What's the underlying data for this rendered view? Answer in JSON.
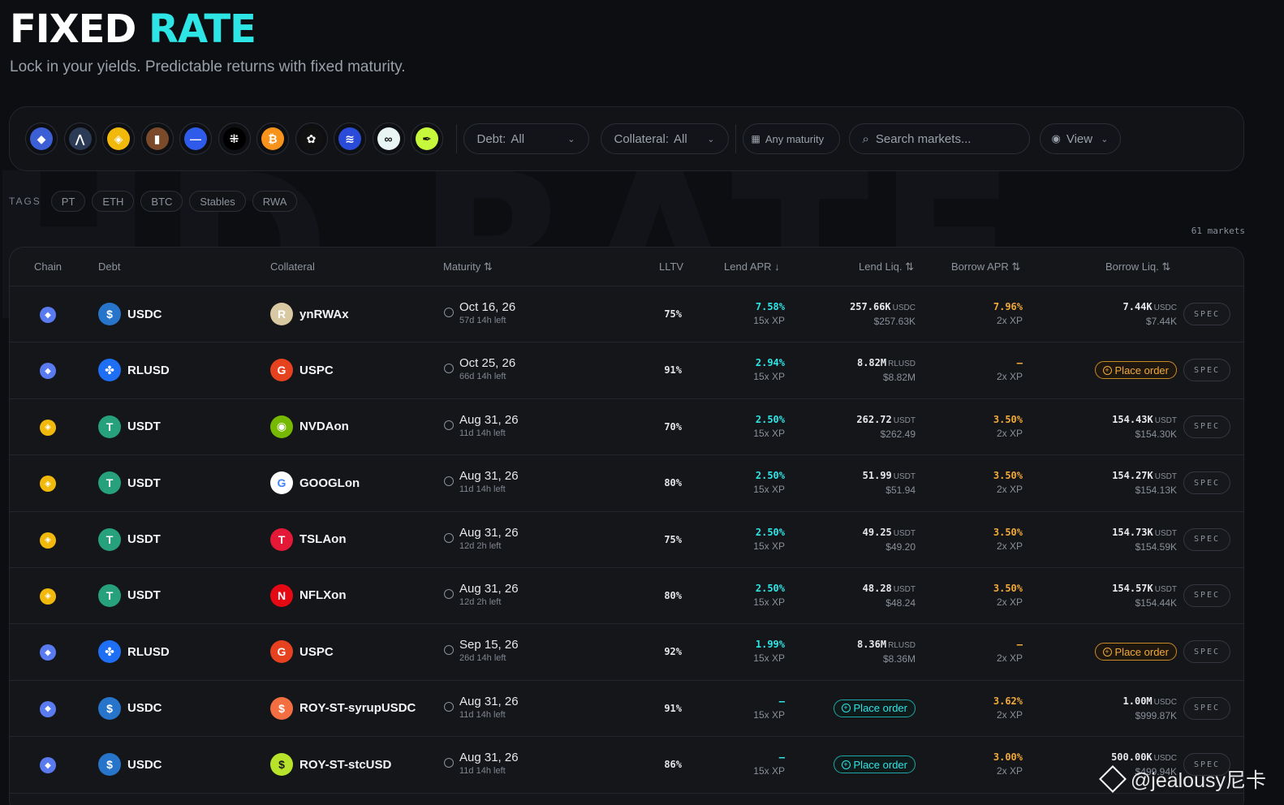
{
  "header": {
    "title_part1": "FIXED",
    "title_part2": "RATE",
    "subtitle": "Lock in your yields. Predictable returns with fixed maturity."
  },
  "filters": {
    "chains": [
      {
        "name": "ethereum-icon",
        "bg": "#3c5fd6",
        "glyph": "◆"
      },
      {
        "name": "arbitrum-icon",
        "bg": "#2b3a55",
        "glyph": "⋀"
      },
      {
        "name": "bnb-icon",
        "bg": "#f0b90b",
        "glyph": "◈"
      },
      {
        "name": "mantle-icon",
        "bg": "#7a4a2a",
        "glyph": "▮"
      },
      {
        "name": "base-icon",
        "bg": "#2f5bea",
        "glyph": "—"
      },
      {
        "name": "okx-icon",
        "bg": "#000000",
        "glyph": "⁜"
      },
      {
        "name": "bitcoin-icon",
        "bg": "#f7931a",
        "glyph": "₿"
      },
      {
        "name": "bera-icon",
        "bg": "#111111",
        "glyph": "✿"
      },
      {
        "name": "stacks-icon",
        "bg": "#2a4bd8",
        "glyph": "≋"
      },
      {
        "name": "hyperliquid-icon",
        "bg": "#e8f5f3",
        "glyph": "∞"
      },
      {
        "name": "feather-icon",
        "bg": "#c6f93c",
        "glyph": "✒"
      }
    ],
    "debt_label": "Debt:",
    "debt_value": "All",
    "collateral_label": "Collateral:",
    "collateral_value": "All",
    "maturity": "Any maturity",
    "search_placeholder": "Search markets...",
    "view": "View"
  },
  "tags": {
    "label": "TAGS",
    "items": [
      "PT",
      "ETH",
      "BTC",
      "Stables",
      "RWA"
    ]
  },
  "markets_count": "61 markets",
  "columns": {
    "chain": "Chain",
    "debt": "Debt",
    "collateral": "Collateral",
    "maturity": "Maturity",
    "lltv": "LLTV",
    "lend_apr": "Lend APR",
    "lend_liq": "Lend Liq.",
    "borrow_apr": "Borrow APR",
    "borrow_liq": "Borrow Liq."
  },
  "spec_label": "SPEC",
  "place_order_label": "Place order",
  "rows": [
    {
      "chain": {
        "icon": "ethereum-icon",
        "bg": "#5a7bef",
        "g": "◆"
      },
      "debt": {
        "name": "USDC",
        "bg": "#2775ca",
        "g": "$"
      },
      "coll": {
        "name": "ynRWAx",
        "bg": "#d9c9a3",
        "g": "R"
      },
      "date": "Oct 16, 26",
      "left": "57d 14h left",
      "lltv": "75%",
      "lend_apr": "7.58%",
      "lend_xp": "15x XP",
      "lend_liq": "257.66K",
      "lend_unit": "USDC",
      "lend_usd": "$257.63K",
      "borrow_apr": "7.96%",
      "borrow_xp": "2x XP",
      "borrow_liq": "7.44K",
      "borrow_unit": "USDC",
      "borrow_usd": "$7.44K"
    },
    {
      "chain": {
        "icon": "ethereum-icon",
        "bg": "#5a7bef",
        "g": "◆"
      },
      "debt": {
        "name": "RLUSD",
        "bg": "#1f6ff5",
        "g": "✤"
      },
      "coll": {
        "name": "USPC",
        "bg": "#e6421f",
        "g": "G"
      },
      "date": "Oct 25, 26",
      "left": "66d 14h left",
      "lltv": "91%",
      "lend_apr": "2.94%",
      "lend_xp": "15x XP",
      "lend_liq": "8.82M",
      "lend_unit": "RLUSD",
      "lend_usd": "$8.82M",
      "borrow_apr": "–",
      "borrow_xp": "2x XP",
      "borrow_order": true
    },
    {
      "chain": {
        "icon": "bnb-icon",
        "bg": "#f0b90b",
        "g": "◈"
      },
      "debt": {
        "name": "USDT",
        "bg": "#26a17b",
        "g": "T"
      },
      "coll": {
        "name": "NVDAon",
        "bg": "#76b900",
        "g": "◉"
      },
      "date": "Aug 31, 26",
      "left": "11d 14h left",
      "lltv": "70%",
      "lend_apr": "2.50%",
      "lend_xp": "15x XP",
      "lend_liq": "262.72",
      "lend_unit": "USDT",
      "lend_usd": "$262.49",
      "borrow_apr": "3.50%",
      "borrow_xp": "2x XP",
      "borrow_liq": "154.43K",
      "borrow_unit": "USDT",
      "borrow_usd": "$154.30K"
    },
    {
      "chain": {
        "icon": "bnb-icon",
        "bg": "#f0b90b",
        "g": "◈"
      },
      "debt": {
        "name": "USDT",
        "bg": "#26a17b",
        "g": "T"
      },
      "coll": {
        "name": "GOOGLon",
        "bg": "#ffffff",
        "g": "G",
        "fg": "#4285f4"
      },
      "date": "Aug 31, 26",
      "left": "11d 14h left",
      "lltv": "80%",
      "lend_apr": "2.50%",
      "lend_xp": "15x XP",
      "lend_liq": "51.99",
      "lend_unit": "USDT",
      "lend_usd": "$51.94",
      "borrow_apr": "3.50%",
      "borrow_xp": "2x XP",
      "borrow_liq": "154.27K",
      "borrow_unit": "USDT",
      "borrow_usd": "$154.13K"
    },
    {
      "chain": {
        "icon": "bnb-icon",
        "bg": "#f0b90b",
        "g": "◈"
      },
      "debt": {
        "name": "USDT",
        "bg": "#26a17b",
        "g": "T"
      },
      "coll": {
        "name": "TSLAon",
        "bg": "#e31937",
        "g": "T"
      },
      "date": "Aug 31, 26",
      "left": "12d 2h left",
      "lltv": "75%",
      "lend_apr": "2.50%",
      "lend_xp": "15x XP",
      "lend_liq": "49.25",
      "lend_unit": "USDT",
      "lend_usd": "$49.20",
      "borrow_apr": "3.50%",
      "borrow_xp": "2x XP",
      "borrow_liq": "154.73K",
      "borrow_unit": "USDT",
      "borrow_usd": "$154.59K"
    },
    {
      "chain": {
        "icon": "bnb-icon",
        "bg": "#f0b90b",
        "g": "◈"
      },
      "debt": {
        "name": "USDT",
        "bg": "#26a17b",
        "g": "T"
      },
      "coll": {
        "name": "NFLXon",
        "bg": "#e50914",
        "g": "N"
      },
      "date": "Aug 31, 26",
      "left": "12d 2h left",
      "lltv": "80%",
      "lend_apr": "2.50%",
      "lend_xp": "15x XP",
      "lend_liq": "48.28",
      "lend_unit": "USDT",
      "lend_usd": "$48.24",
      "borrow_apr": "3.50%",
      "borrow_xp": "2x XP",
      "borrow_liq": "154.57K",
      "borrow_unit": "USDT",
      "borrow_usd": "$154.44K"
    },
    {
      "chain": {
        "icon": "ethereum-icon",
        "bg": "#5a7bef",
        "g": "◆"
      },
      "debt": {
        "name": "RLUSD",
        "bg": "#1f6ff5",
        "g": "✤"
      },
      "coll": {
        "name": "USPC",
        "bg": "#e6421f",
        "g": "G"
      },
      "date": "Sep 15, 26",
      "left": "26d 14h left",
      "lltv": "92%",
      "lend_apr": "1.99%",
      "lend_xp": "15x XP",
      "lend_liq": "8.36M",
      "lend_unit": "RLUSD",
      "lend_usd": "$8.36M",
      "borrow_apr": "–",
      "borrow_xp": "2x XP",
      "borrow_order": true
    },
    {
      "chain": {
        "icon": "ethereum-icon",
        "bg": "#5a7bef",
        "g": "◆"
      },
      "debt": {
        "name": "USDC",
        "bg": "#2775ca",
        "g": "$"
      },
      "coll": {
        "name": "ROY-ST-syrupUSDC",
        "bg": "#f36f42",
        "g": "$"
      },
      "date": "Aug 31, 26",
      "left": "11d 14h left",
      "lltv": "91%",
      "lend_apr": "–",
      "lend_xp": "15x XP",
      "lend_order": true,
      "borrow_apr": "3.62%",
      "borrow_xp": "2x XP",
      "borrow_liq": "1.00M",
      "borrow_unit": "USDC",
      "borrow_usd": "$999.87K"
    },
    {
      "chain": {
        "icon": "ethereum-icon",
        "bg": "#5a7bef",
        "g": "◆"
      },
      "debt": {
        "name": "USDC",
        "bg": "#2775ca",
        "g": "$"
      },
      "coll": {
        "name": "ROY-ST-stcUSD",
        "bg": "#b7e32a",
        "g": "$",
        "fg": "#1a1a1a"
      },
      "date": "Aug 31, 26",
      "left": "11d 14h left",
      "lltv": "86%",
      "lend_apr": "–",
      "lend_xp": "15x XP",
      "lend_order": true,
      "borrow_apr": "3.00%",
      "borrow_xp": "2x XP",
      "borrow_liq": "500.00K",
      "borrow_unit": "USDC",
      "borrow_usd": "$499.94K"
    }
  ],
  "watermark": "@jealousy尼卡"
}
